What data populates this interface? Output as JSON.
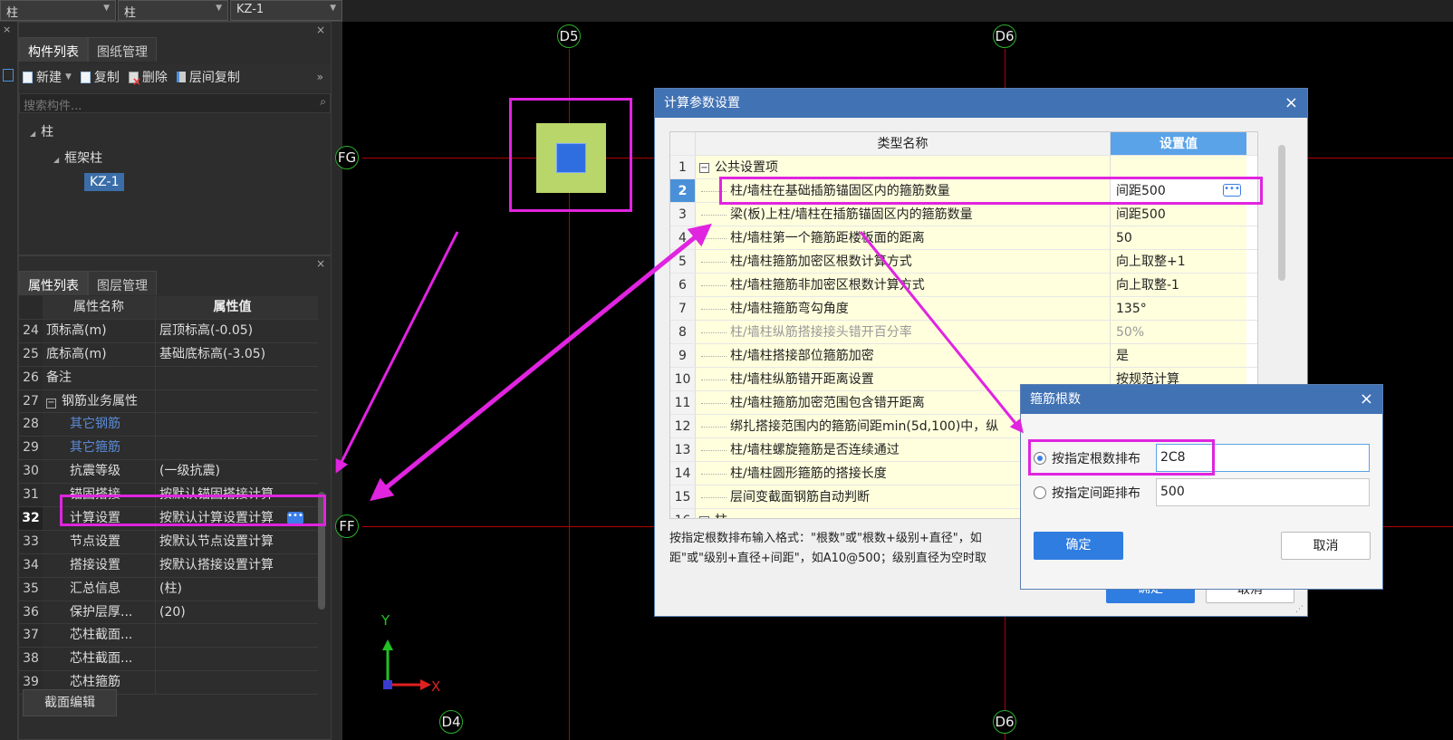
{
  "topbar": {
    "combo1": "柱",
    "combo2": "柱",
    "combo3": "KZ-1"
  },
  "component_panel": {
    "tabs": [
      "构件列表",
      "图纸管理"
    ],
    "toolbar": {
      "new_label": "新建",
      "copy_label": "复制",
      "delete_label": "删除",
      "floor_copy_label": "层间复制"
    },
    "search_placeholder": "搜索构件...",
    "tree": {
      "root": "柱",
      "child": "框架柱",
      "leaf": "KZ-1"
    }
  },
  "property_panel": {
    "tabs": [
      "属性列表",
      "图层管理"
    ],
    "header": {
      "name": "属性名称",
      "value": "属性值"
    },
    "rows": [
      {
        "num": "24",
        "name": "顶标高(m)",
        "value": "层顶标高(-0.05)"
      },
      {
        "num": "25",
        "name": "底标高(m)",
        "value": "基础底标高(-3.05)"
      },
      {
        "num": "26",
        "name": "备注",
        "value": ""
      },
      {
        "num": "27",
        "name": "钢筋业务属性",
        "value": ""
      },
      {
        "num": "28",
        "name": "其它钢筋",
        "value": ""
      },
      {
        "num": "29",
        "name": "其它箍筋",
        "value": ""
      },
      {
        "num": "30",
        "name": "抗震等级",
        "value": "(一级抗震)"
      },
      {
        "num": "31",
        "name": "锚固搭接",
        "value": "按默认锚固搭接计算"
      },
      {
        "num": "32",
        "name": "计算设置",
        "value": "按默认计算设置计算"
      },
      {
        "num": "33",
        "name": "节点设置",
        "value": "按默认节点设置计算"
      },
      {
        "num": "34",
        "name": "搭接设置",
        "value": "按默认搭接设置计算"
      },
      {
        "num": "35",
        "name": "汇总信息",
        "value": "(柱)"
      },
      {
        "num": "36",
        "name": "保护层厚...",
        "value": "(20)"
      },
      {
        "num": "37",
        "name": "芯柱截面...",
        "value": ""
      },
      {
        "num": "38",
        "name": "芯柱截面...",
        "value": ""
      },
      {
        "num": "39",
        "name": "芯柱箍筋",
        "value": ""
      }
    ],
    "section_button": "截面编辑"
  },
  "canvas": {
    "axis_labels": {
      "d5": "D5",
      "d6_top": "D6",
      "fg": "FG",
      "ff": "FF",
      "d4": "D4",
      "d6_bottom": "D6"
    },
    "ucs": {
      "y": "Y",
      "x": "X"
    },
    "colors": {
      "grid_line": "#b40000",
      "highlight": "#e024e0",
      "bubble": "#2ab02a"
    }
  },
  "calc_dialog": {
    "title": "计算参数设置",
    "header": {
      "name": "类型名称",
      "value": "设置值"
    },
    "rows": [
      {
        "num": "1",
        "name": "公共设置项",
        "value": ""
      },
      {
        "num": "2",
        "name": "柱/墙柱在基础插筋锚固区内的箍筋数量",
        "value": "间距500"
      },
      {
        "num": "3",
        "name": "梁(板)上柱/墙柱在插筋锚固区内的箍筋数量",
        "value": "间距500"
      },
      {
        "num": "4",
        "name": "柱/墙柱第一个箍筋距楼板面的距离",
        "value": "50"
      },
      {
        "num": "5",
        "name": "柱/墙柱箍筋加密区根数计算方式",
        "value": "向上取整+1"
      },
      {
        "num": "6",
        "name": "柱/墙柱箍筋非加密区根数计算方式",
        "value": "向上取整-1"
      },
      {
        "num": "7",
        "name": "柱/墙柱箍筋弯勾角度",
        "value": "135°"
      },
      {
        "num": "8",
        "name": "柱/墙柱纵筋搭接接头错开百分率",
        "value": "50%"
      },
      {
        "num": "9",
        "name": "柱/墙柱搭接部位箍筋加密",
        "value": "是"
      },
      {
        "num": "10",
        "name": "柱/墙柱纵筋错开距离设置",
        "value": "按规范计算"
      },
      {
        "num": "11",
        "name": "柱/墙柱箍筋加密范围包含错开距离",
        "value": ""
      },
      {
        "num": "12",
        "name": "绑扎搭接范围内的箍筋间距min(5d,100)中，纵",
        "value": ""
      },
      {
        "num": "13",
        "name": "柱/墙柱螺旋箍筋是否连续通过",
        "value": ""
      },
      {
        "num": "14",
        "name": "柱/墙柱圆形箍筋的搭接长度",
        "value": ""
      },
      {
        "num": "15",
        "name": "层间变截面钢筋自动判断",
        "value": ""
      },
      {
        "num": "16",
        "name": "柱",
        "value": ""
      }
    ],
    "hint_line1": "按指定根数排布输入格式：\"根数\"或\"根数+级别+直径\"，如",
    "hint_line2": "距\"或\"级别+直径+间距\"，如A10@500；级别直径为空时取",
    "ok_label": "确定",
    "cancel_label": "取消"
  },
  "stirrup_dialog": {
    "title": "箍筋根数",
    "option1_label": "按指定根数排布",
    "option1_value": "2C8",
    "option2_label": "按指定间距排布",
    "option2_value": "500",
    "ok_label": "确定",
    "cancel_label": "取消"
  }
}
